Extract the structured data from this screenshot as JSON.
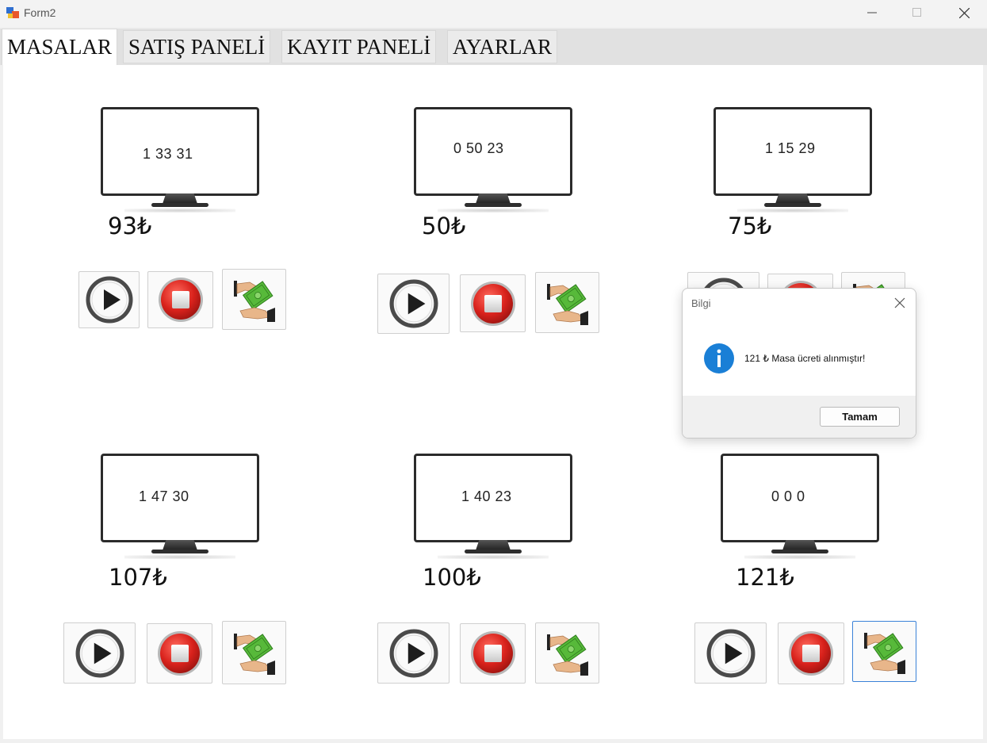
{
  "window": {
    "title": "Form2"
  },
  "tabs": [
    "MASALAR",
    "SATIŞ PANELİ",
    "KAYIT PANELİ",
    "AYARLAR"
  ],
  "tables": [
    {
      "timer": "1    33   31",
      "price": "93₺"
    },
    {
      "timer": "0    50   23",
      "price": "50₺"
    },
    {
      "timer": "1    15   29",
      "price": "75₺"
    },
    {
      "timer": "1    47   30",
      "price": "107₺"
    },
    {
      "timer": "1    40   23",
      "price": "100₺"
    },
    {
      "timer": "0     0     0",
      "price": "121₺"
    }
  ],
  "icons": {
    "start": "play-icon",
    "stop": "stop-icon",
    "pay": "money-payment-icon"
  },
  "dialog": {
    "title": "Bilgi",
    "message": "121 ₺ Masa ücreti alınmıştır!",
    "ok_label": "Tamam",
    "icon": "info-icon"
  },
  "colors": {
    "stop_red": "#d9221c",
    "focus_blue": "#3b82d8",
    "info_blue": "#1a7fd6",
    "money_green": "#3fae2a"
  }
}
